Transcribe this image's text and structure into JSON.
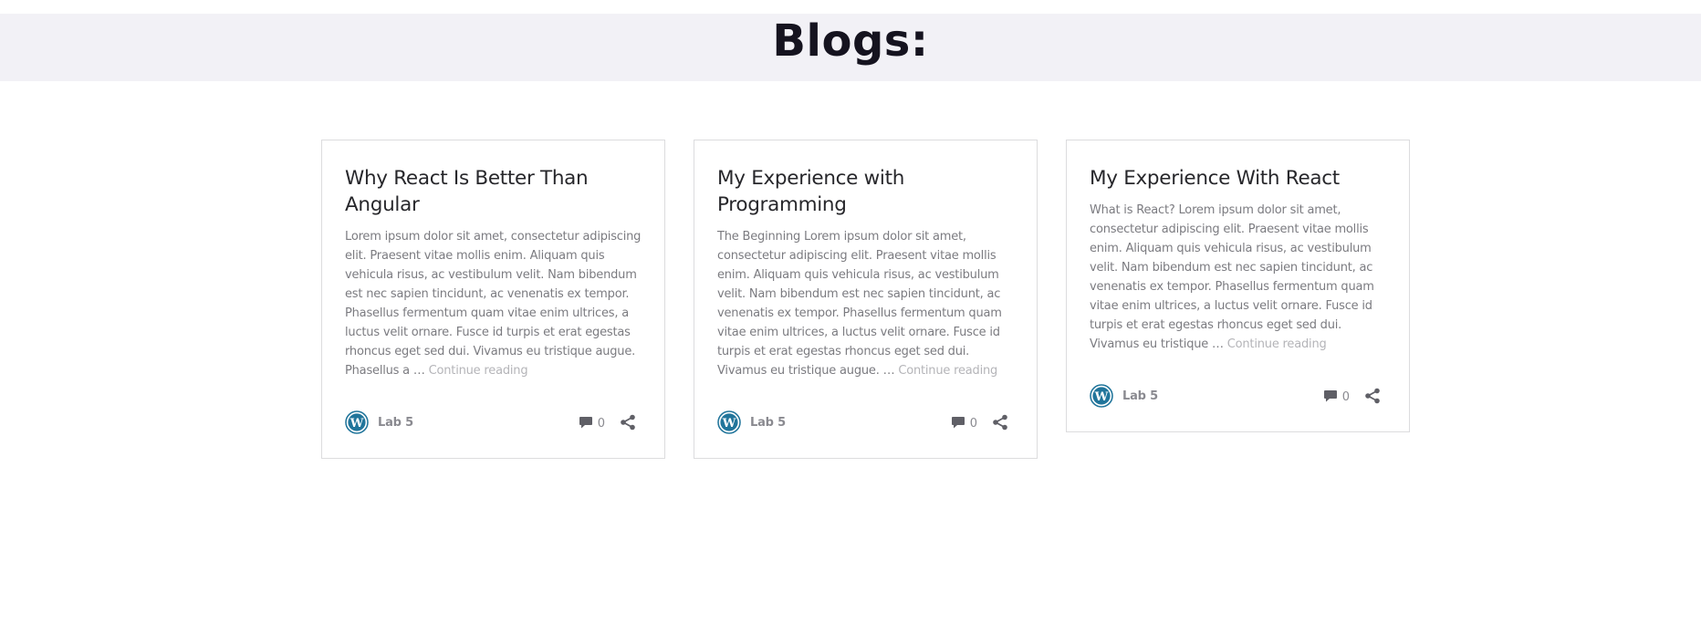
{
  "banner": {
    "title": "Blogs:"
  },
  "posts": [
    {
      "title": "Why React Is Better Than Angular",
      "excerpt": "Lorem ipsum dolor sit amet, consectetur adipiscing elit. Praesent vitae mollis enim. Aliquam quis vehicula risus, ac vestibulum velit. Nam bibendum est nec sapien tincidunt, ac venenatis ex tempor. Phasellus fermentum quam vitae enim ultrices, a luctus velit ornare. Fusce id turpis et erat egestas rhoncus eget sed dui. Vivamus eu tristique augue. Phasellus a …",
      "continue_label": "Continue reading",
      "author": "Lab 5",
      "comment_count": "0",
      "author_icon": "wordpress-icon"
    },
    {
      "title": "My Experience with Programming",
      "excerpt": "The Beginning Lorem ipsum dolor sit amet, consectetur adipiscing elit. Praesent vitae mollis enim. Aliquam quis vehicula risus, ac vestibulum velit. Nam bibendum est nec sapien tincidunt, ac venenatis ex tempor. Phasellus fermentum quam vitae enim ultrices, a luctus velit ornare. Fusce id turpis et erat egestas rhoncus eget sed dui. Vivamus eu tristique augue. …",
      "continue_label": "Continue reading",
      "author": "Lab 5",
      "comment_count": "0",
      "author_icon": "wordpress-icon"
    },
    {
      "title": "My Experience With React",
      "excerpt": "What is React? Lorem ipsum dolor sit amet, consectetur adipiscing elit. Praesent vitae mollis enim. Aliquam quis vehicula risus, ac vestibulum velit. Nam bibendum est nec sapien tincidunt, ac venenatis ex tempor. Phasellus fermentum quam vitae enim ultrices, a luctus velit ornare. Fusce id turpis et erat egestas rhoncus eget sed dui. Vivamus eu tristique …",
      "continue_label": "Continue reading",
      "author": "Lab 5",
      "comment_count": "0",
      "author_icon": "wordpress-icon"
    }
  ],
  "colors": {
    "banner_bg": "#f2f1f6",
    "title_text": "#15131f",
    "card_border": "#dcdcde",
    "excerpt_text": "#7b7b80",
    "link_text": "#b4b4b8",
    "wordpress_blue": "#21759b",
    "icon_gray": "#5f5f66"
  }
}
